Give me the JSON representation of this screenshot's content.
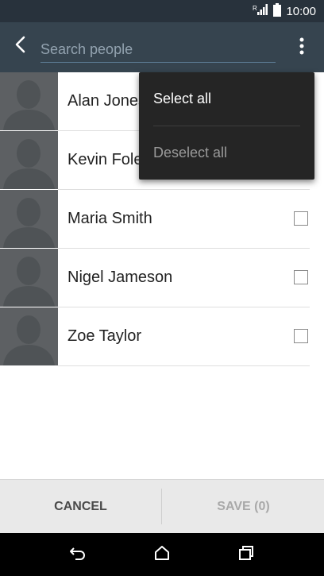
{
  "status_bar": {
    "time": "10:00",
    "signal_icon": "signal-icon",
    "battery_icon": "battery-icon"
  },
  "header": {
    "search_placeholder": "Search people",
    "back_icon": "back-arrow-icon",
    "overflow_icon": "more-vert-icon"
  },
  "contacts": [
    {
      "name": "Alan Jones",
      "checked": false
    },
    {
      "name": "Kevin Foley",
      "checked": false
    },
    {
      "name": "Maria Smith",
      "checked": false
    },
    {
      "name": "Nigel Jameson",
      "checked": false
    },
    {
      "name": "Zoe Taylor",
      "checked": false
    }
  ],
  "menu": {
    "items": [
      {
        "label": "Select all"
      },
      {
        "label": "Deselect all"
      }
    ]
  },
  "actions": {
    "cancel_label": "CANCEL",
    "save_label": "SAVE (0)"
  },
  "nav": {
    "back": "back-nav-icon",
    "home": "home-icon",
    "recents": "recents-icon"
  },
  "colors": {
    "app_bar": "#36444f",
    "status_bar": "#28323c",
    "menu_bg": "#252525",
    "avatar_bg": "#5d6063"
  }
}
